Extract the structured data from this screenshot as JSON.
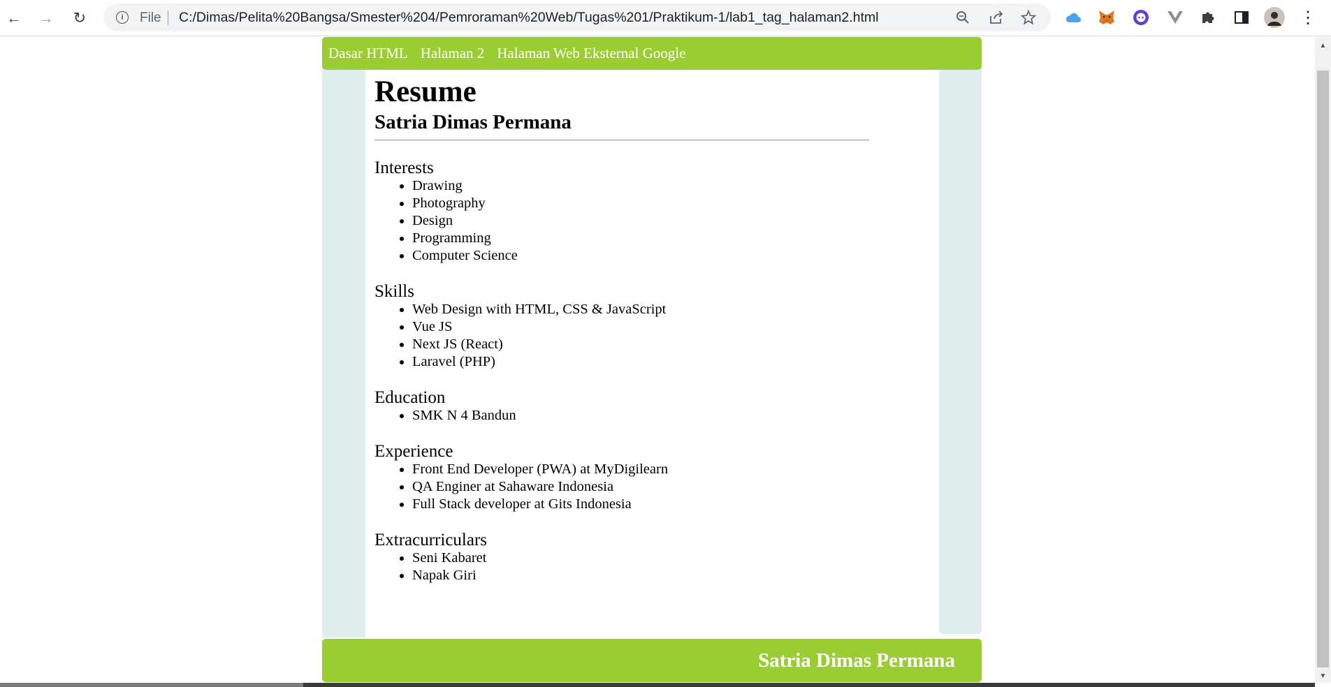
{
  "browser": {
    "back_icon": "←",
    "forward_icon": "→",
    "reload_icon": "↻",
    "info_icon": "i",
    "scheme_label": "File",
    "url": "C:/Dimas/Pelita%20Bangsa/Smester%204/Pemroraman%20Web/Tugas%201/Praktikum-1/lab1_tag_halaman2.html",
    "menu_icon": "⋮"
  },
  "nav": {
    "links": [
      "Dasar HTML",
      "Halaman 2",
      "Halaman Web Eksternal Google"
    ]
  },
  "resume": {
    "title": "Resume",
    "name": "Satria Dimas Permana",
    "sections": [
      {
        "title": "Interests",
        "items": [
          "Drawing",
          "Photography",
          "Design",
          "Programming",
          "Computer Science"
        ]
      },
      {
        "title": "Skills",
        "items": [
          "Web Design with HTML, CSS & JavaScript",
          "Vue JS",
          "Next JS (React)",
          "Laravel (PHP)"
        ]
      },
      {
        "title": "Education",
        "items": [
          "SMK N 4 Bandun"
        ]
      },
      {
        "title": "Experience",
        "items": [
          "Front End Developer (PWA) at MyDigilearn",
          "QA Enginer at Sahaware Indonesia",
          "Full Stack developer at Gits Indonesia"
        ]
      },
      {
        "title": "Extracurriculars",
        "items": [
          "Seni Kabaret",
          "Napak Giri"
        ]
      }
    ]
  },
  "footer": {
    "name": "Satria Dimas Permana"
  },
  "colors": {
    "accent": "#9acd32",
    "sidebar": "#dfeeed"
  }
}
